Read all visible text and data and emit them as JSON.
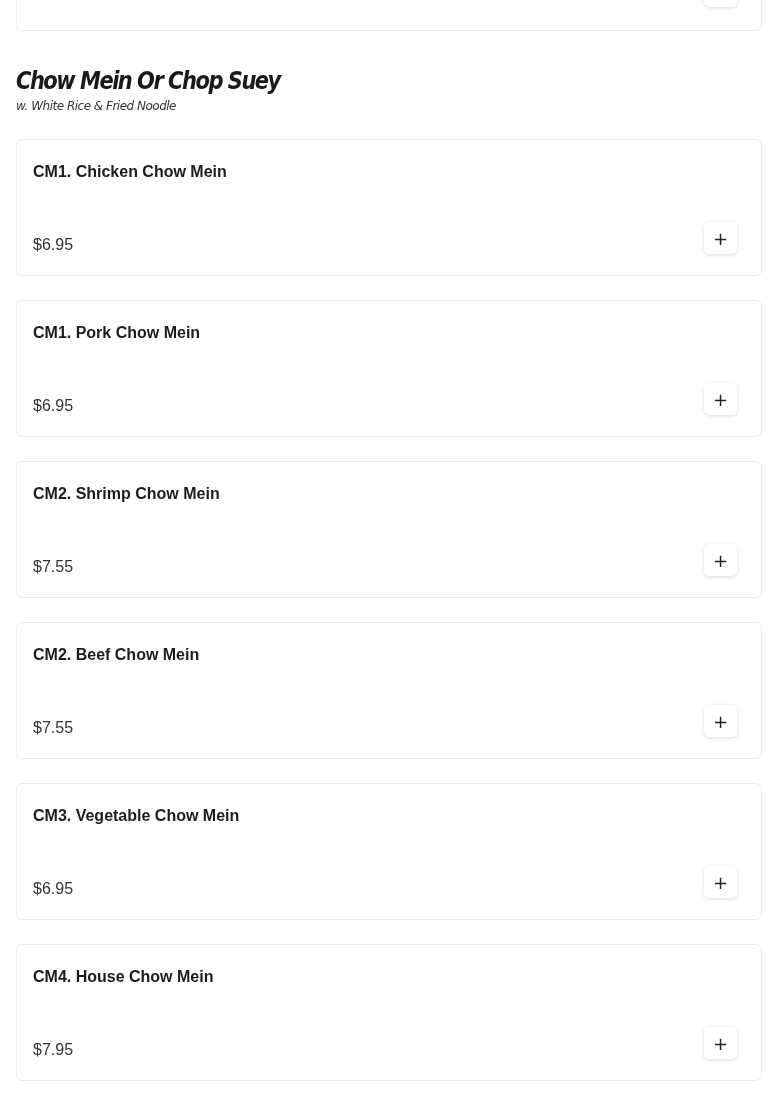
{
  "section": {
    "title": "Chow Mein Or Chop Suey",
    "subtitle": "w. White Rice & Fried Noodle"
  },
  "items": [
    {
      "name": "CM1. Chicken Chow Mein",
      "price": "$6.95",
      "add_button": "+"
    },
    {
      "name": "CM1. Pork Chow Mein",
      "price": "$6.95",
      "add_button": "+"
    },
    {
      "name": "CM2. Shrimp Chow Mein",
      "price": "$7.55",
      "add_button": "+"
    },
    {
      "name": "CM2. Beef Chow Mein",
      "price": "$7.55",
      "add_button": "+"
    },
    {
      "name": "CM3. Vegetable Chow Mein",
      "price": "$6.95",
      "add_button": "+"
    },
    {
      "name": "CM4. House Chow Mein",
      "price": "$7.95",
      "add_button": "+"
    }
  ]
}
